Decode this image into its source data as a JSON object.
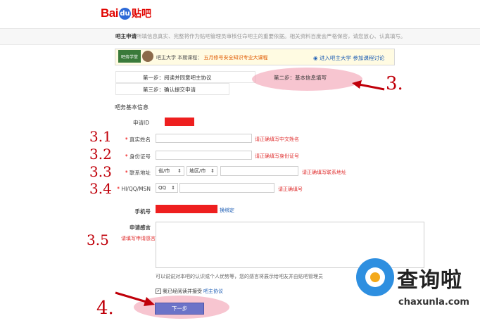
{
  "header": {
    "logo_bai": "Bai",
    "logo_paw": "du",
    "logo_tieba": "贴吧",
    "notice_bold": "吧主申请",
    "notice_text": "所填信息真实、完整将作为贴吧管理员审核任命吧主的重要依据。相关资料百度会严格保密，请您放心、认真填写。"
  },
  "banner": {
    "badge": "吧务学堂",
    "text_a": "吧主大学",
    "text_b": "本期课程：",
    "text_c": "五月修号安全知识专业大课程",
    "link_enter": "进入吧主大学",
    "link_discuss": "参加课程讨论"
  },
  "steps": {
    "step1": "第一步：阅读并同意吧主协议",
    "step2": "第二步：基本信息填写",
    "step3": "第三步：确认提交申请"
  },
  "annotations": {
    "a3": "3.",
    "a31": "3.1",
    "a32": "3.2",
    "a33": "3.3",
    "a34": "3.4",
    "a35": "3.5",
    "a4": "4."
  },
  "form": {
    "section_title": "吧务基本信息",
    "apply_id_label": "申请ID",
    "required_mark": "*",
    "real_name_label": "真实姓名",
    "real_name_hint": "请正确填写中文姓名",
    "id_card_label": "身份证号",
    "id_card_hint": "请正确填写身份证号",
    "address_label": "联系地址",
    "province_value": "省/市",
    "district_value": "地区/市",
    "address_hint": "请正确填写联系地址",
    "im_label": "HI/QQ/MSN",
    "im_type_value": "QQ",
    "im_hint": "请正确填号",
    "phone_label": "手机号",
    "phone_change_link": "换绑定",
    "message_label": "申请感言",
    "message_hint": "请填写申请感言",
    "message_desc": "可以说说对本吧的认识或个人优势等，您的感言将展示给吧友并由贴吧管理员",
    "agree_prefix": "我已经阅读并接受",
    "agree_link": "吧主协议",
    "agree_check": "✔",
    "next_button": "下一步"
  },
  "watermark": {
    "title": "查询啦",
    "url": "chaxunla.com"
  },
  "colors": {
    "annotation_red": "#c0000a",
    "highlight_pink": "#f096aa",
    "link_blue": "#1f5fb5",
    "button_purple": "#6c73c8",
    "redaction_red": "#ee1f1f"
  }
}
